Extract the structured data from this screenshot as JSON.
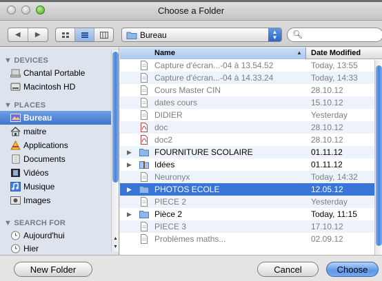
{
  "window": {
    "title": "Choose a Folder"
  },
  "toolbar": {
    "back_glyph": "◀",
    "forward_glyph": "▶",
    "location": "Bureau",
    "search_placeholder": ""
  },
  "sidebar": {
    "sections": [
      {
        "title": "▼ DEVICES",
        "items": [
          {
            "label": "Chantal Portable",
            "icon": "laptop-icon"
          },
          {
            "label": "Macintosh HD",
            "icon": "hard-drive-icon"
          }
        ]
      },
      {
        "title": "▼ PLACES",
        "items": [
          {
            "label": "Bureau",
            "icon": "desktop-icon",
            "selected": true
          },
          {
            "label": "maitre",
            "icon": "home-icon"
          },
          {
            "label": "Applications",
            "icon": "applications-icon"
          },
          {
            "label": "Documents",
            "icon": "documents-icon"
          },
          {
            "label": "Vidéos",
            "icon": "movies-icon"
          },
          {
            "label": "Musique",
            "icon": "music-icon"
          },
          {
            "label": "Images",
            "icon": "pictures-icon"
          }
        ]
      },
      {
        "title": "▼ SEARCH FOR",
        "items": [
          {
            "label": "Aujourd'hui",
            "icon": "clock-icon"
          },
          {
            "label": "Hier",
            "icon": "clock-icon"
          }
        ]
      }
    ]
  },
  "filelist": {
    "columns": {
      "name": "Name",
      "date": "Date Modified"
    },
    "rows": [
      {
        "name": "Capture d'écran...-04 à 13.54.52",
        "date": "Today, 13:55",
        "kind": "doc"
      },
      {
        "name": "Capture d'écran...-04 à 14.33.24",
        "date": "Today, 14:33",
        "kind": "doc"
      },
      {
        "name": "Cours Master CIN",
        "date": "28.10.12",
        "kind": "doc"
      },
      {
        "name": "dates cours",
        "date": "15.10.12",
        "kind": "doc"
      },
      {
        "name": "DIDIER",
        "date": "Yesterday",
        "kind": "doc"
      },
      {
        "name": "doc",
        "date": "28.10.12",
        "kind": "pdf"
      },
      {
        "name": "doc2",
        "date": "28.10.12",
        "kind": "pdf"
      },
      {
        "name": "FOURNITURE SCOLAIRE",
        "date": "01.11.12",
        "kind": "folder"
      },
      {
        "name": "Idées",
        "date": "01.11.12",
        "kind": "folder-zip"
      },
      {
        "name": "Neuronyx",
        "date": "Today, 14:32",
        "kind": "doc"
      },
      {
        "name": "PHOTOS ECOLE",
        "date": "12.05.12",
        "kind": "folder",
        "selected": true
      },
      {
        "name": "PIECE 2",
        "date": "Yesterday",
        "kind": "doc"
      },
      {
        "name": "Pièce 2",
        "date": "Today, 11:15",
        "kind": "folder"
      },
      {
        "name": "PIECE 3",
        "date": "17.10.12",
        "kind": "doc"
      },
      {
        "name": "Problèmes maths...",
        "date": "02.09.12",
        "kind": "doc"
      }
    ]
  },
  "buttons": {
    "new_folder": "New Folder",
    "cancel": "Cancel",
    "choose": "Choose"
  }
}
